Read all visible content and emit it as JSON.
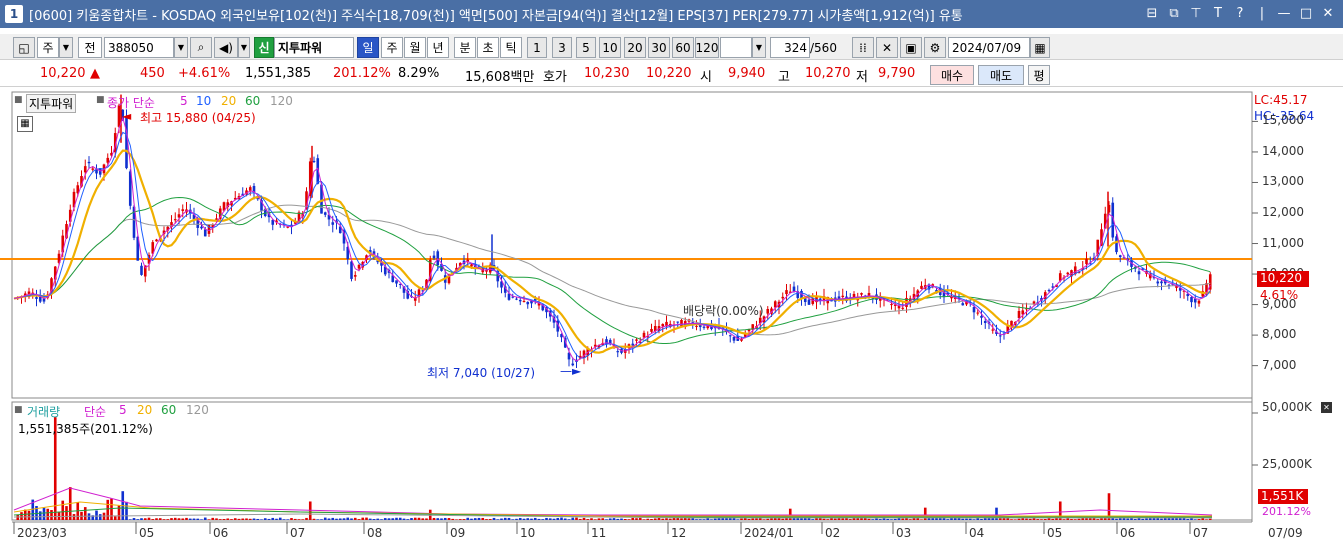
{
  "window": {
    "number": "1",
    "title": "[0600] 키움종합차트 - KOSDAQ 외국인보유[102(천)] 주식수[18,709(천)] 액면[500] 자본금[94(억)] 결산[12월] EPS[37] PER[279.77] 시가총액[1,912(억)] 유통"
  },
  "toolbar": {
    "period_label": "주",
    "prev_label": "전",
    "code": "388050",
    "shin_label": "신",
    "name": "지투파워",
    "day": "일",
    "week": "주",
    "month": "월",
    "year": "년",
    "minute": "분",
    "tick_cho": "초",
    "tick": "틱",
    "intervals": [
      "1",
      "3",
      "5",
      "10",
      "20",
      "30",
      "60",
      "120"
    ],
    "count_current": "324",
    "count_total": "/560",
    "date": "2024/07/09"
  },
  "quote": {
    "price": "10,220",
    "arrow": "▲",
    "change": "450",
    "change_pct": "+4.61%",
    "volume": "1,551,385",
    "volume_ratio": "201.12%",
    "turnover": "8.29%",
    "amount": "15,608백만",
    "hoga_label": "호가",
    "ask": "10,230",
    "bid": "10,220",
    "open_label": "시",
    "open": "9,940",
    "high_label": "고",
    "high": "10,270",
    "low_label": "저",
    "low": "9,790",
    "buy_label": "매수",
    "sell_label": "매도",
    "eval_label": "평"
  },
  "price_panel": {
    "name_tag": "지투파워",
    "ma_label": "종가 단순",
    "ma_periods": [
      "5",
      "10",
      "20",
      "60",
      "120"
    ],
    "high_annot": "최고 15,880 (04/25)",
    "low_annot": "최저 7,040 (10/27)",
    "dividend_annot": "배당락(0.00%)",
    "lc": "LC:45.17",
    "hc": "HC:-35.64",
    "current_price": "10,220",
    "current_pct": "4.61%",
    "y_ticks": [
      "15,000",
      "14,000",
      "13,000",
      "12,000",
      "11,000",
      "10,000",
      "9,000",
      "8,000",
      "7,000"
    ],
    "y_values": [
      15000,
      14000,
      13000,
      12000,
      11000,
      10000,
      9000,
      8000,
      7000
    ]
  },
  "volume_panel": {
    "label": "거래량",
    "ma_label": "단순",
    "ma_periods": [
      "5",
      "20",
      "60",
      "120"
    ],
    "current": "1,551,385주(201.12%)",
    "y_ticks": [
      "50,000K",
      "25,000K"
    ],
    "badge": "1,551K",
    "badge_pct": "201.12%"
  },
  "x_axis": {
    "labels": [
      "2023/03",
      "05",
      "06",
      "07",
      "08",
      "09",
      "10",
      "11",
      "12",
      "2024/01",
      "02",
      "03",
      "04",
      "05",
      "06",
      "07"
    ],
    "end_label": "07/09"
  },
  "colors": {
    "up": "#e00000",
    "down": "#1030d0",
    "ma5": "#d020d0",
    "ma10": "#2060ff",
    "ma20": "#f0b000",
    "ma60": "#20a040",
    "ma120": "#999999",
    "hline": "#ff8c00"
  }
}
